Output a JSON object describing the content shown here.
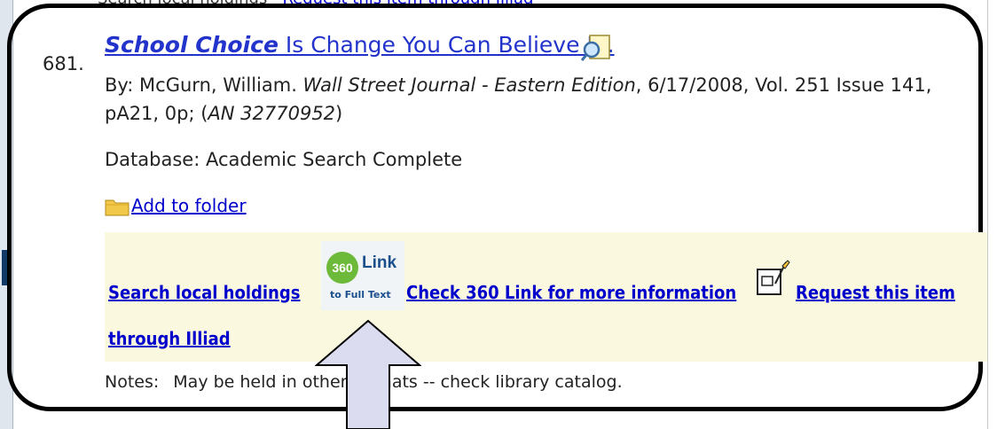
{
  "top_partial": {
    "prefix": "Search local holdings  ·  ",
    "link": "Request this item through Illiad"
  },
  "result": {
    "number": "681.",
    "title_bold": "School Choice",
    "title_rest": " Is Change You Can Believe In.",
    "byline_1": "By: McGurn, William. ",
    "journal": "Wall Street Journal - Eastern Edition",
    "byline_1_rest": ", 6/17/2008, Vol. 251 Issue 141,",
    "byline_2a": "pA21, 0p; (",
    "an": "AN 32770952",
    "byline_2b": ")",
    "database": "Database: Academic Search Complete",
    "add_folder": "Add to folder",
    "search_local": "Search local holdings",
    "link360_num": "360",
    "link360_word": "Link",
    "link360_sub": "to Full Text",
    "check360": "Check 360 Link for more information",
    "request": "Request this item",
    "through": "through Illiad",
    "notes_label": "Notes:",
    "notes_text": "May be held in other formats -- check library catalog."
  },
  "colors": {
    "link": "#0000cc",
    "panel_bg": "#fbf8e0",
    "frame": "#000000",
    "arrow_fill": "#dcdcf0"
  },
  "icons": [
    "detailed-record-icon",
    "folder-icon",
    "request-form-icon",
    "pointer-arrow"
  ]
}
